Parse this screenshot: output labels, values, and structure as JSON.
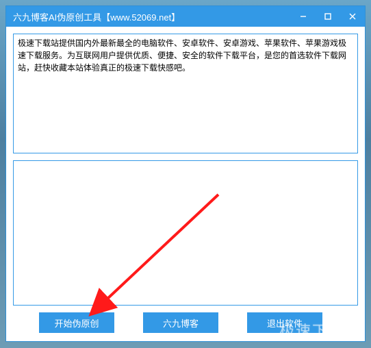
{
  "window": {
    "title": "六九博客AI伪原创工具【www.52069.net】"
  },
  "textareas": {
    "input_value": "极速下载站提供国内外最新最全的电脑软件、安卓软件、安卓游戏、苹果软件、苹果游戏极速下载服务。为互联网用户提供优质、便捷、安全的软件下载平台，是您的首选软件下载网站，赶快收藏本站体验真正的极速下载快感吧。",
    "output_value": ""
  },
  "buttons": {
    "start": "开始伪原创",
    "blog": "六九博客",
    "exit": "退出软件"
  },
  "watermark": "极速下载站"
}
